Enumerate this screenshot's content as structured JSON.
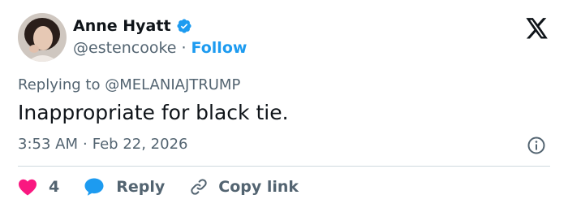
{
  "author": {
    "name": "Anne Hyatt",
    "handle": "@estencooke",
    "follow_label": "Follow",
    "separator": "·"
  },
  "tweet": {
    "replying_to": "Replying to @MELANIAJTRUMP",
    "text": "Inappropriate for black tie.",
    "time": "3:53 AM",
    "date": "Feb 22, 2026",
    "separator": "·"
  },
  "actions": {
    "like_count": "4",
    "reply_label": "Reply",
    "copy_link_label": "Copy link"
  },
  "colors": {
    "like": "#f91880",
    "reply": "#1d9bf0",
    "verified": "#1d9bf0",
    "link": "#1d9bf0",
    "muted": "#536471"
  },
  "icons": [
    "verified-badge-icon",
    "x-logo-icon",
    "info-icon",
    "heart-icon",
    "reply-bubble-icon",
    "link-icon"
  ]
}
